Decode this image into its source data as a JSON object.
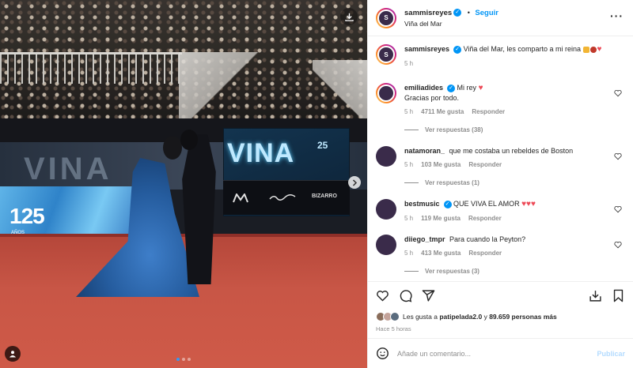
{
  "post": {
    "username": "sammisreyes",
    "follow_label": "Seguir",
    "separator": "•",
    "location": "Viña del Mar",
    "caption_user": "sammisreyes",
    "caption": "Viña del Mar, les comparto a mi reina",
    "caption_time": "5 h"
  },
  "media": {
    "left_screen_text": "125",
    "left_screen_sub": "AÑOS",
    "vina_logo": "VINA",
    "vina_number": "25",
    "sponsors": [
      "",
      "",
      "BIZARRO"
    ],
    "carousel_dots": 3,
    "active_dot": 0
  },
  "comments": [
    {
      "user": "emiliadides",
      "verified": true,
      "text": "Mi rey",
      "text2": "Gracias por todo.",
      "time": "5 h",
      "likes": "4711 Me gusta",
      "reply": "Responder",
      "replies": "Ver respuestas (38)"
    },
    {
      "user": "natamoran_",
      "verified": false,
      "text": "que me costaba un rebeldes de Boston",
      "time": "5 h",
      "likes": "103 Me gusta",
      "reply": "Responder",
      "replies": "Ver respuestas (1)"
    },
    {
      "user": "bestmusic",
      "verified": true,
      "text": "QUE VIVA EL AMOR",
      "time": "5 h",
      "likes": "119 Me gusta",
      "reply": "Responder",
      "replies": ""
    },
    {
      "user": "diiego_tmpr",
      "verified": false,
      "text": "Para cuando la Peyton?",
      "time": "5 h",
      "likes": "413 Me gusta",
      "reply": "Responder",
      "replies": "Ver respuestas (3)"
    }
  ],
  "likes": {
    "prefix": "Les gusta a",
    "first_user": "patipelada2.0",
    "middle": "y",
    "others": "89.659 personas más"
  },
  "time_ago": "Hace 5 horas",
  "composer": {
    "placeholder": "Añade un comentario...",
    "publish": "Publicar"
  },
  "colors": {
    "accent": "#0095f6",
    "publish_disabled": "#b3dbff",
    "heart_red": "#ed4956"
  },
  "icons": [
    "download-icon",
    "next-arrow-icon",
    "tag-user-icon",
    "more-icon",
    "heart-icon",
    "comment-icon",
    "share-icon",
    "save-icon",
    "bookmark-icon",
    "emoji-icon"
  ]
}
